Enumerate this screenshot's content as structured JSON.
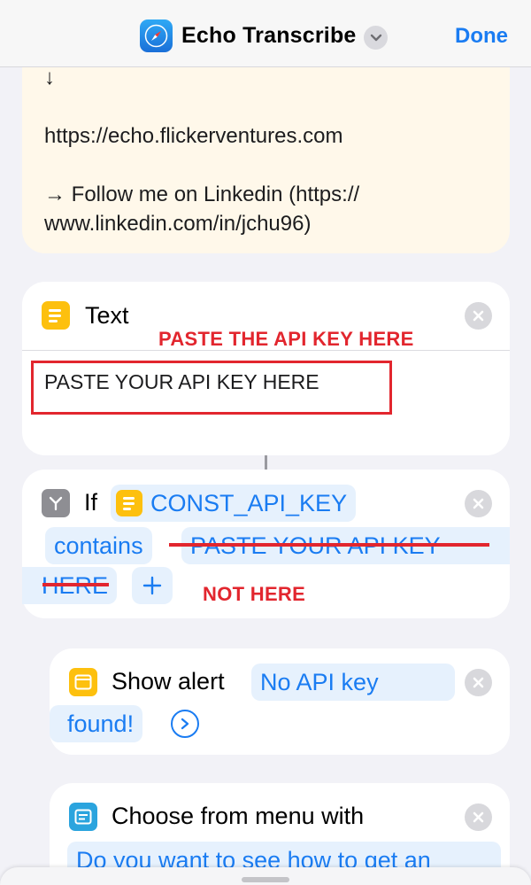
{
  "header": {
    "title": "Echo Transcribe",
    "done_label": "Done",
    "app_icon": "safari-compass-icon",
    "title_menu_icon": "chevron-down-icon"
  },
  "comment": {
    "arrow_glyph": "↓",
    "url_line": "https://echo.flickerventures.com",
    "linkedin_line1": "→ Follow me on Linkedin (https://",
    "linkedin_line2": "www.linkedin.com/in/jchu96)"
  },
  "text_action": {
    "title": "Text",
    "value": "PASTE YOUR API KEY HERE",
    "annotation": "PASTE THE API KEY HERE"
  },
  "if_action": {
    "keyword": "If",
    "variable": "CONST_API_KEY",
    "condition": "contains",
    "compare_part1": "PASTE YOUR API KEY",
    "compare_part2": "HERE",
    "plus": "+",
    "annotation": "NOT HERE"
  },
  "alert_action": {
    "title": "Show alert",
    "message_part1": "No API key",
    "message_part2": "found!"
  },
  "menu_action": {
    "title": "Choose from menu with",
    "prompt_partial": "Do you want to see how to get an"
  },
  "colors": {
    "accent": "#1a7cf2",
    "annotation_red": "#e2262e",
    "text_icon": "#fdc00e",
    "menu_icon": "#2ba4de",
    "comment_bg": "#fff8ea"
  }
}
